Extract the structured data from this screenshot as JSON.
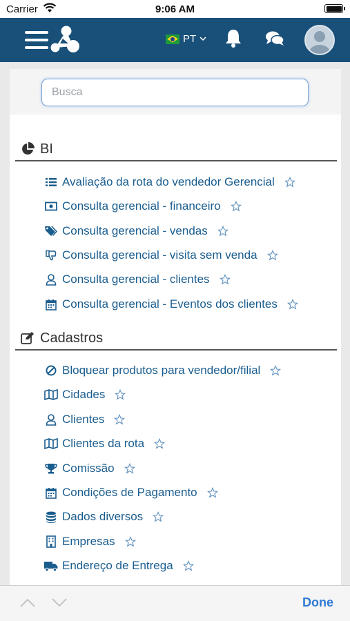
{
  "status_bar": {
    "carrier": "Carrier",
    "time": "9:06 AM"
  },
  "header": {
    "language": "PT",
    "icons": [
      "menu-icon",
      "app-logo",
      "brazil-flag-icon",
      "chevron-down-icon",
      "bell-icon",
      "chat-icon",
      "avatar"
    ]
  },
  "search": {
    "placeholder": "Busca",
    "value": ""
  },
  "sections": [
    {
      "title": "BI",
      "icon": "pie-chart-icon",
      "items": [
        {
          "label": "Avaliação da rota do vendedor Gerencial",
          "icon": "list-icon"
        },
        {
          "label": "Consulta gerencial - financeiro",
          "icon": "money-icon"
        },
        {
          "label": "Consulta gerencial - vendas",
          "icon": "tags-icon"
        },
        {
          "label": "Consulta gerencial - visita sem venda",
          "icon": "thumbs-down-icon"
        },
        {
          "label": "Consulta gerencial - clientes",
          "icon": "user-icon"
        },
        {
          "label": "Consulta gerencial - Eventos dos clientes",
          "icon": "calendar-icon"
        }
      ]
    },
    {
      "title": "Cadastros",
      "icon": "edit-icon",
      "items": [
        {
          "label": "Bloquear produtos para vendedor/filial",
          "icon": "ban-icon"
        },
        {
          "label": "Cidades",
          "icon": "map-icon"
        },
        {
          "label": "Clientes",
          "icon": "user-icon"
        },
        {
          "label": "Clientes da rota",
          "icon": "map-icon"
        },
        {
          "label": "Comissão",
          "icon": "trophy-icon"
        },
        {
          "label": "Condições de Pagamento",
          "icon": "calendar-icon"
        },
        {
          "label": "Dados diversos",
          "icon": "database-icon"
        },
        {
          "label": "Empresas",
          "icon": "building-icon"
        },
        {
          "label": "Endereço de Entrega",
          "icon": "truck-icon"
        }
      ]
    }
  ],
  "accessory": {
    "done_label": "Done"
  },
  "colors": {
    "header": "#185079",
    "link": "#1a5d8f",
    "accent": "#2f7ad4"
  }
}
